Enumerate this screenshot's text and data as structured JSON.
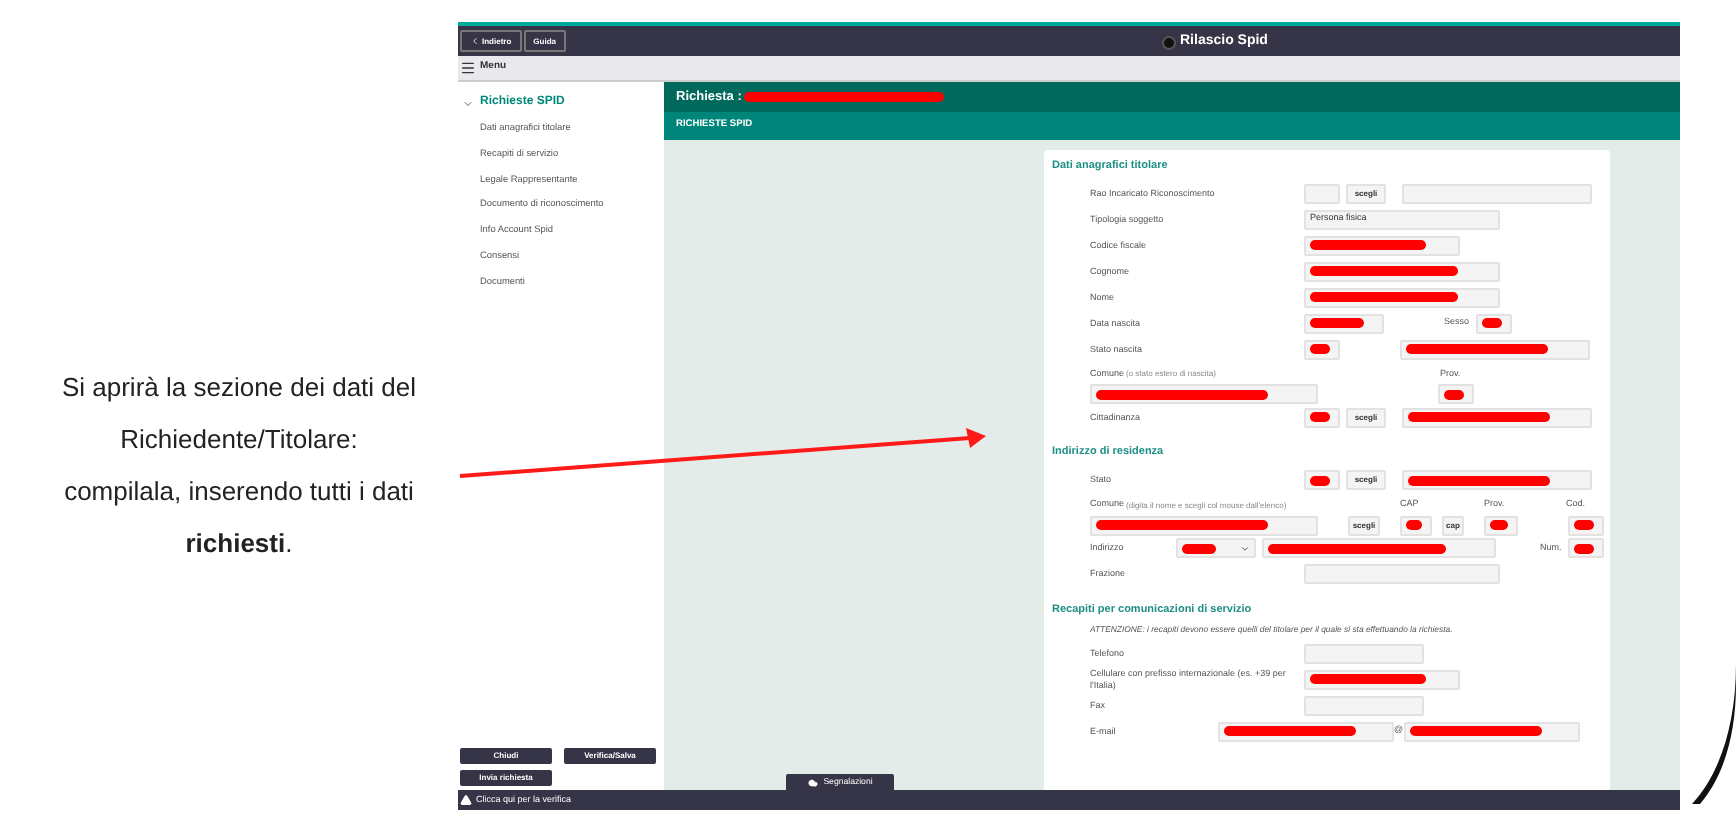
{
  "caption": "Si aprirà la sezione dei dati del Richiedente/Titolare: compilala, inserendo tutti i dati **richiesti**.",
  "topbar": {
    "buttons": [
      "Indietro",
      "Guida"
    ],
    "title": "Rilascio Spid"
  },
  "menubar": {
    "label": "Menu"
  },
  "sidebar": {
    "group": {
      "label": "Richieste SPID",
      "expanded": true
    },
    "items": [
      "Dati anagrafici titolare",
      "Recapiti di servizio",
      "Legale Rappresentante",
      "Documento di riconoscimento",
      "Info Account Spid",
      "Consensi",
      "Documenti"
    ],
    "buttons": [
      "Chiudi",
      "Verifica/Salva",
      "Invia richiesta"
    ]
  },
  "header": {
    "title": "Richiesta :",
    "redacted": true,
    "subtitle": "RICHIESTE SPID"
  },
  "sections": [
    {
      "title": "Dati anagrafici titolare",
      "rows": [
        {
          "label": "Rao Incaricato Riconoscimento",
          "cells": [
            {
              "kind": "field",
              "redacted": false
            },
            {
              "kind": "button",
              "text": "scegli"
            },
            {
              "kind": "field",
              "redacted": false
            }
          ]
        },
        {
          "label": "Tipologia soggetto",
          "cells": [
            {
              "kind": "field",
              "value": "Persona fisica",
              "redacted": false
            }
          ]
        },
        {
          "label": "Codice fiscale",
          "cells": [
            {
              "kind": "field",
              "redacted": true
            }
          ]
        },
        {
          "label": "Cognome",
          "cells": [
            {
              "kind": "field",
              "redacted": true
            }
          ]
        },
        {
          "label": "Nome",
          "cells": [
            {
              "kind": "field",
              "redacted": true
            }
          ]
        },
        {
          "label": "Data nascita",
          "cells": [
            {
              "kind": "field",
              "redacted": true
            },
            {
              "kind": "label",
              "text": "Sesso"
            },
            {
              "kind": "field",
              "redacted": true
            }
          ]
        },
        {
          "label": "Stato nascita",
          "cells": [
            {
              "kind": "field",
              "redacted": true
            },
            {
              "kind": "field",
              "redacted": true
            }
          ]
        },
        {
          "label": "Comune",
          "note": "(o stato estero di nascita)",
          "headers": [
            "Prov."
          ],
          "cells": [
            {
              "kind": "field",
              "redacted": true
            },
            {
              "kind": "field",
              "redacted": true
            }
          ]
        },
        {
          "label": "Cittadinanza",
          "cells": [
            {
              "kind": "field",
              "redacted": true
            },
            {
              "kind": "button",
              "text": "scegli"
            },
            {
              "kind": "field",
              "redacted": true
            }
          ]
        }
      ]
    },
    {
      "title": "Indirizzo di residenza",
      "rows": [
        {
          "label": "Stato",
          "cells": [
            {
              "kind": "field",
              "redacted": true
            },
            {
              "kind": "button",
              "text": "scegli"
            },
            {
              "kind": "field",
              "redacted": true
            }
          ]
        },
        {
          "label": "Comune",
          "note": "(digita il nome e scegli col mouse dall'elenco)",
          "headers": [
            "CAP",
            "Prov.",
            "Cod."
          ],
          "cells": [
            {
              "kind": "field",
              "redacted": true
            },
            {
              "kind": "button",
              "text": "scegli"
            },
            {
              "kind": "field",
              "redacted": true
            },
            {
              "kind": "button",
              "text": "cap"
            },
            {
              "kind": "field",
              "redacted": true
            },
            {
              "kind": "field",
              "redacted": true
            }
          ]
        },
        {
          "label": "Indirizzo",
          "cells": [
            {
              "kind": "select",
              "redacted": true
            },
            {
              "kind": "field",
              "redacted": true
            },
            {
              "kind": "label",
              "text": "Num."
            },
            {
              "kind": "field",
              "redacted": true
            }
          ]
        },
        {
          "label": "Frazione",
          "cells": [
            {
              "kind": "field",
              "redacted": false
            }
          ]
        }
      ]
    },
    {
      "title": "Recapiti per comunicazioni di servizio",
      "note": "ATTENZIONE: i recapiti devono essere quelli del titolare per il quale si sta effettuando la richiesta.",
      "rows": [
        {
          "label": "Telefono",
          "cells": [
            {
              "kind": "field",
              "redacted": false
            }
          ]
        },
        {
          "label": "Cellulare con prefisso internazionale (es. +39 per l'Italia)",
          "cells": [
            {
              "kind": "field",
              "redacted": true
            }
          ]
        },
        {
          "label": "Fax",
          "cells": [
            {
              "kind": "field",
              "redacted": false
            }
          ]
        },
        {
          "label": "E-mail",
          "cells": [
            {
              "kind": "field",
              "redacted": true
            },
            {
              "kind": "label",
              "text": "@"
            },
            {
              "kind": "field",
              "redacted": true
            }
          ]
        }
      ]
    }
  ],
  "footer_tab": "Segnalazioni",
  "status_bar": "Clicca qui per la verifica"
}
